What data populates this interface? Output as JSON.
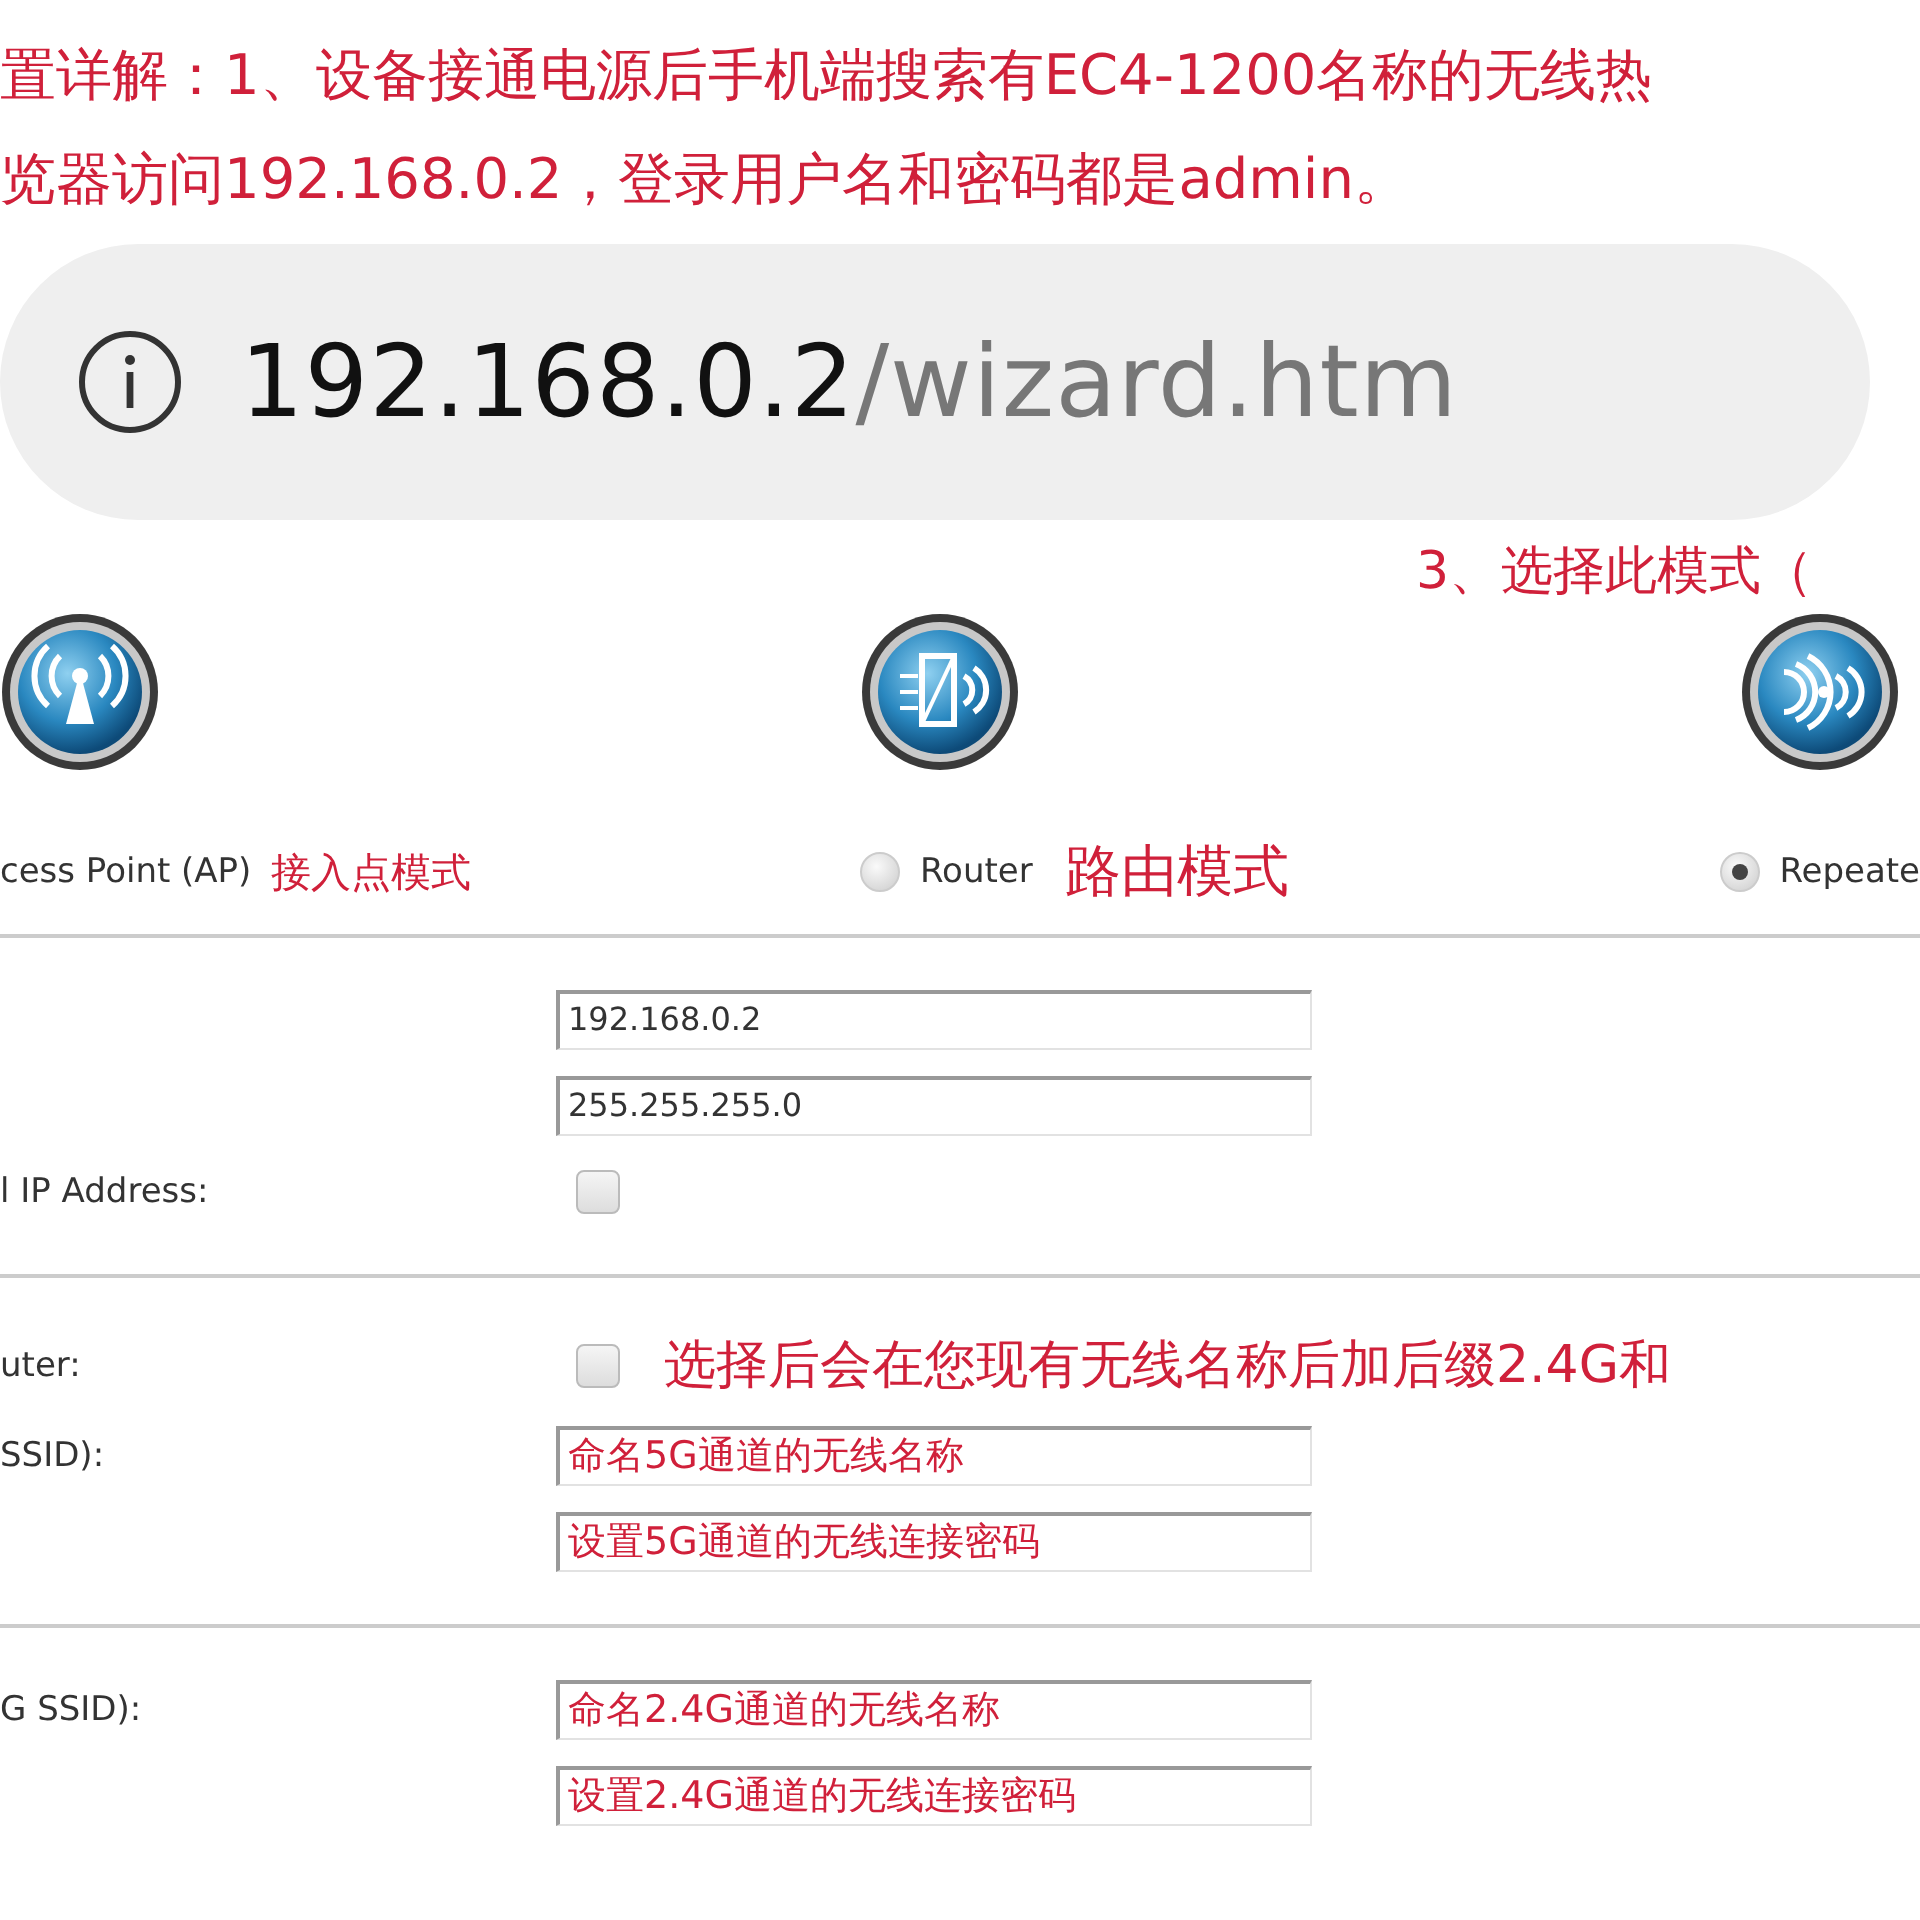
{
  "annotations_top": [
    "置详解：1、设备接通电源后手机端搜索有EC4-1200名称的无线热",
    "览器访问192.168.0.2，登录用户名和密码都是admin。"
  ],
  "address_bar": {
    "host": "192.168.0.2",
    "path": "/wizard.htm"
  },
  "mode_note": "3、选择此模式（",
  "modes": [
    {
      "kind": "antenna",
      "label": "cess Point (AP)",
      "note": "接入点模式"
    },
    {
      "kind": "router",
      "label": "Router",
      "selected": false,
      "note": "路由模式"
    },
    {
      "kind": "repeater",
      "label": "Repeate",
      "selected": true
    }
  ],
  "sections": [
    {
      "rows": [
        {
          "kind": "field",
          "value": "192.168.0.2",
          "annotated": false
        },
        {
          "kind": "field",
          "value": "255.255.255.0",
          "annotated": false
        },
        {
          "kind": "checkbox",
          "label": "l IP Address:",
          "checked": false
        }
      ]
    },
    {
      "rows": [
        {
          "kind": "checkbox",
          "label": "uter:",
          "checked": false,
          "note": "选择后会在您现有无线名称后加后缀2.4G和"
        },
        {
          "kind": "field",
          "label": "SSID):",
          "value": "命名5G通道的无线名称",
          "annotated": true
        },
        {
          "kind": "field",
          "value": "设置5G通道的无线连接密码",
          "annotated": true
        }
      ]
    },
    {
      "rows": [
        {
          "kind": "field",
          "label": "G SSID):",
          "value": "命名2.4G通道的无线名称",
          "annotated": true
        },
        {
          "kind": "field",
          "value": "设置2.4G通道的无线连接密码",
          "annotated": true
        }
      ]
    }
  ]
}
